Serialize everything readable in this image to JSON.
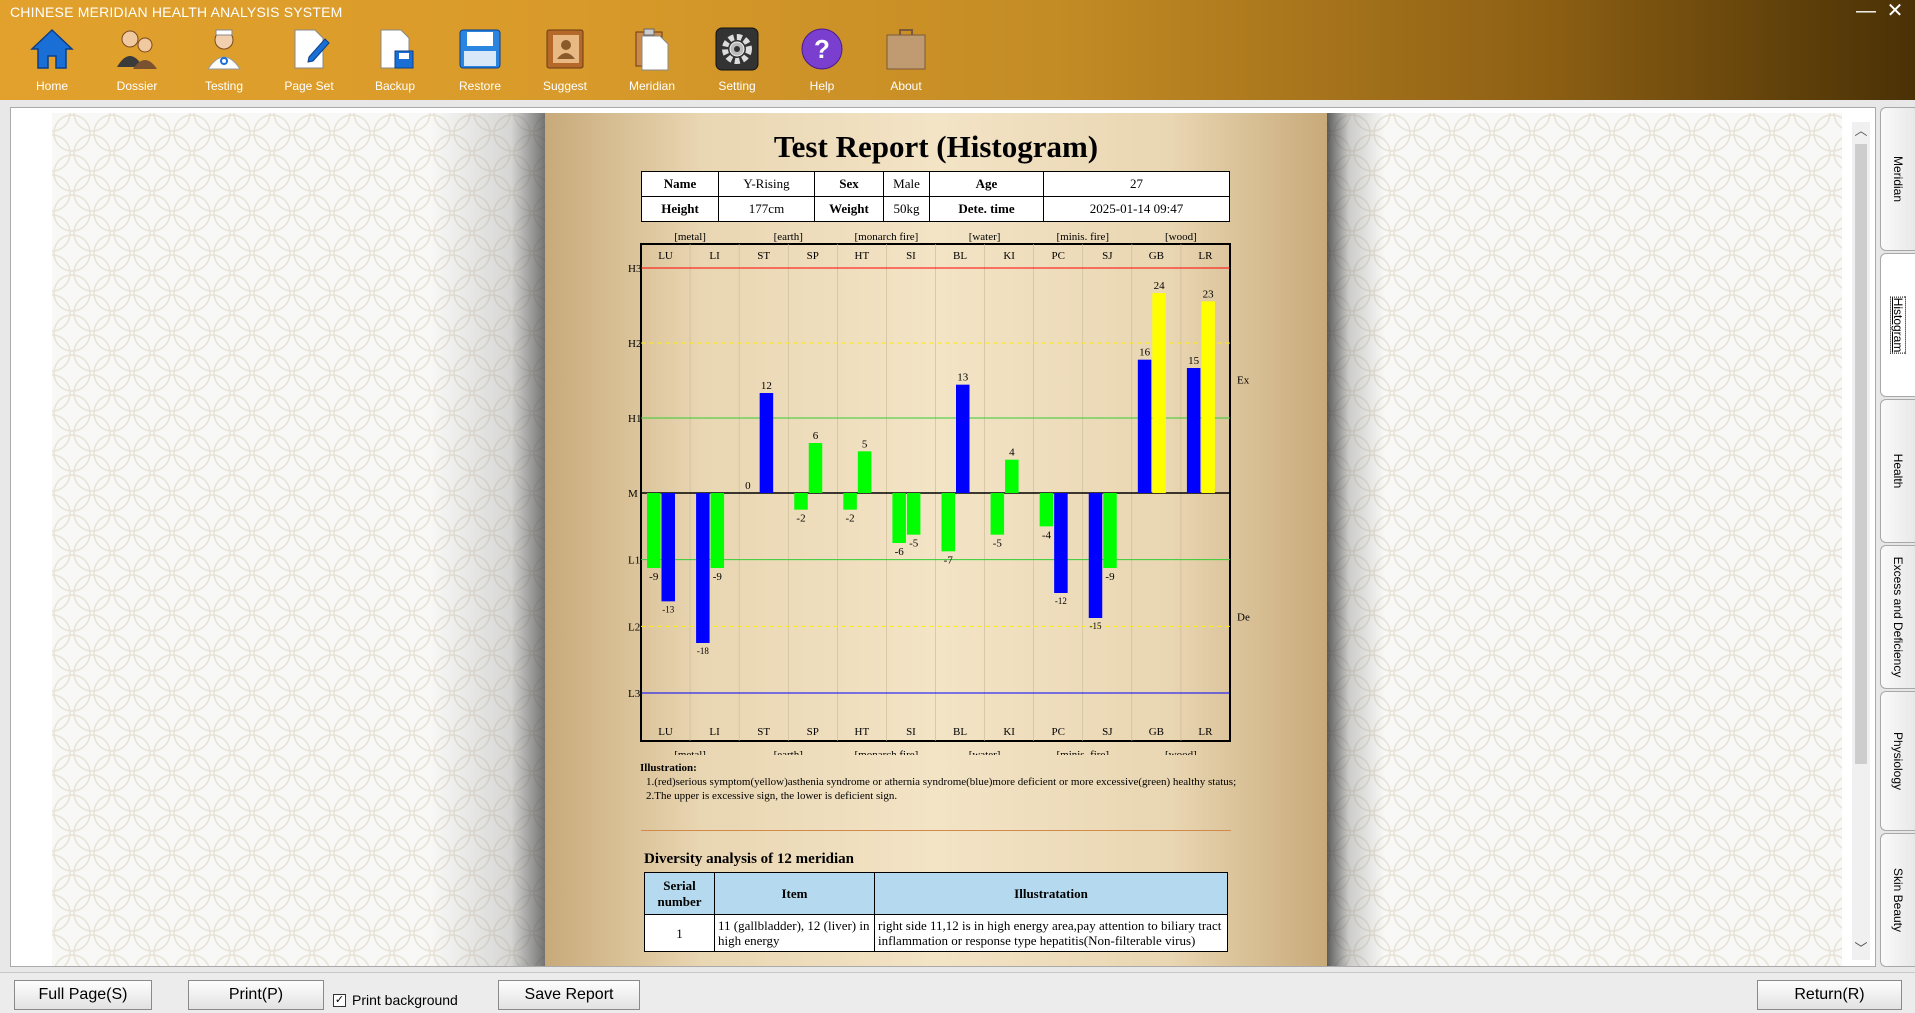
{
  "app": {
    "title": "CHINESE MERIDIAN HEALTH ANALYSIS SYSTEM",
    "min_glyph": "—",
    "close_glyph": "✕"
  },
  "toolbar": [
    {
      "label": "Home",
      "icon": "home-icon"
    },
    {
      "label": "Dossier",
      "icon": "users-icon"
    },
    {
      "label": "Testing",
      "icon": "doctor-icon"
    },
    {
      "label": "Page Set",
      "icon": "page-edit-icon"
    },
    {
      "label": "Backup",
      "icon": "backup-icon"
    },
    {
      "label": "Restore",
      "icon": "restore-icon"
    },
    {
      "label": "Suggest",
      "icon": "suggest-book-icon"
    },
    {
      "label": "Meridian",
      "icon": "clipboard-icon"
    },
    {
      "label": "Setting",
      "icon": "gear-icon"
    },
    {
      "label": "Help",
      "icon": "help-icon"
    },
    {
      "label": "About",
      "icon": "about-bag-icon"
    }
  ],
  "report": {
    "title": "Test Report (Histogram)",
    "info": {
      "name_label": "Name",
      "name": "Y-Rising",
      "sex_label": "Sex",
      "sex": "Male",
      "age_label": "Age",
      "age": "27",
      "height_label": "Height",
      "height": "177cm",
      "weight_label": "Weight",
      "weight": "50kg",
      "time_label": "Dete. time",
      "time": "2025-01-14 09:47"
    },
    "illustration": {
      "title": "Illustration:",
      "line1": "1.(red)serious symptom(yellow)asthenia syndrome or athernia syndrome(blue)more deficient or more excessive(green) healthy status;",
      "line2": "2.The upper is excessive sign, the lower is deficient sign."
    },
    "diversity": {
      "title": "Diversity analysis of 12 meridian",
      "headers": [
        "Serial number",
        "Item",
        "Illustratation"
      ],
      "rows": [
        [
          "1",
          "11 (gallbladder), 12 (liver) in high energy",
          "right side 11,12 is in high energy area,pay attention to biliary tract inflammation or response type hepatitis(Non-filterable virus)"
        ]
      ]
    }
  },
  "chart_data": {
    "type": "bar",
    "categories": [
      "LU",
      "LI",
      "ST",
      "SP",
      "HT",
      "SI",
      "BL",
      "KI",
      "PC",
      "SJ",
      "GB",
      "LR"
    ],
    "element_groups": [
      "[metal]",
      "[earth]",
      "[monarch fire]",
      "[water]",
      "[minis. fire]",
      "[wood]"
    ],
    "y_levels": [
      "H3",
      "H2",
      "H1",
      "M",
      "L1",
      "L2",
      "L3"
    ],
    "y_level_values": [
      27,
      18,
      9,
      0,
      -8,
      -16,
      -24
    ],
    "ylim": [
      -24.6,
      27
    ],
    "right_labels": {
      "upper": "Ex",
      "lower": "De"
    },
    "series": [
      {
        "values": [
          -9,
          -18,
          0,
          -2,
          -2,
          -6,
          -7,
          -5,
          -4,
          -15,
          16,
          15
        ],
        "colors": [
          "#00ff00",
          "#0000ff",
          "#0000ff",
          "#00ff00",
          "#00ff00",
          "#00ff00",
          "#00ff00",
          "#00ff00",
          "#00ff00",
          "#0000ff",
          "#0000ff",
          "#0000ff"
        ]
      },
      {
        "values": [
          -13,
          -9,
          12,
          6,
          5,
          -5,
          13,
          4,
          -12,
          -9,
          24,
          23
        ],
        "colors": [
          "#0000ff",
          "#00ff00",
          "#0000ff",
          "#00ff00",
          "#00ff00",
          "#00ff00",
          "#0000ff",
          "#00ff00",
          "#0000ff",
          "#00ff00",
          "#ffff00",
          "#ffff00"
        ]
      }
    ],
    "level_line_colors": {
      "H3": "#ff0000",
      "H2": "#ffee00",
      "H1": "#33cc33",
      "M": "#000000",
      "L1": "#33cc33",
      "L2": "#ffee00",
      "L3": "#0000ff"
    }
  },
  "side_tabs": [
    {
      "label": "Meridian",
      "active": false
    },
    {
      "label": "Histogram",
      "active": true
    },
    {
      "label": "Health",
      "active": false
    },
    {
      "label": "Excess and Deficiency",
      "active": false
    },
    {
      "label": "Physiology",
      "active": false
    },
    {
      "label": "Skin Beauty",
      "active": false
    }
  ],
  "scroll": {
    "up_glyph": "︿",
    "down_glyph": "﹀"
  },
  "bottom": {
    "full_page": "Full Page(S)",
    "print": "Print(P)",
    "print_background": "Print background",
    "print_background_checked": true,
    "check_glyph": "✓",
    "save_report": "Save Report",
    "return": "Return(R)"
  }
}
